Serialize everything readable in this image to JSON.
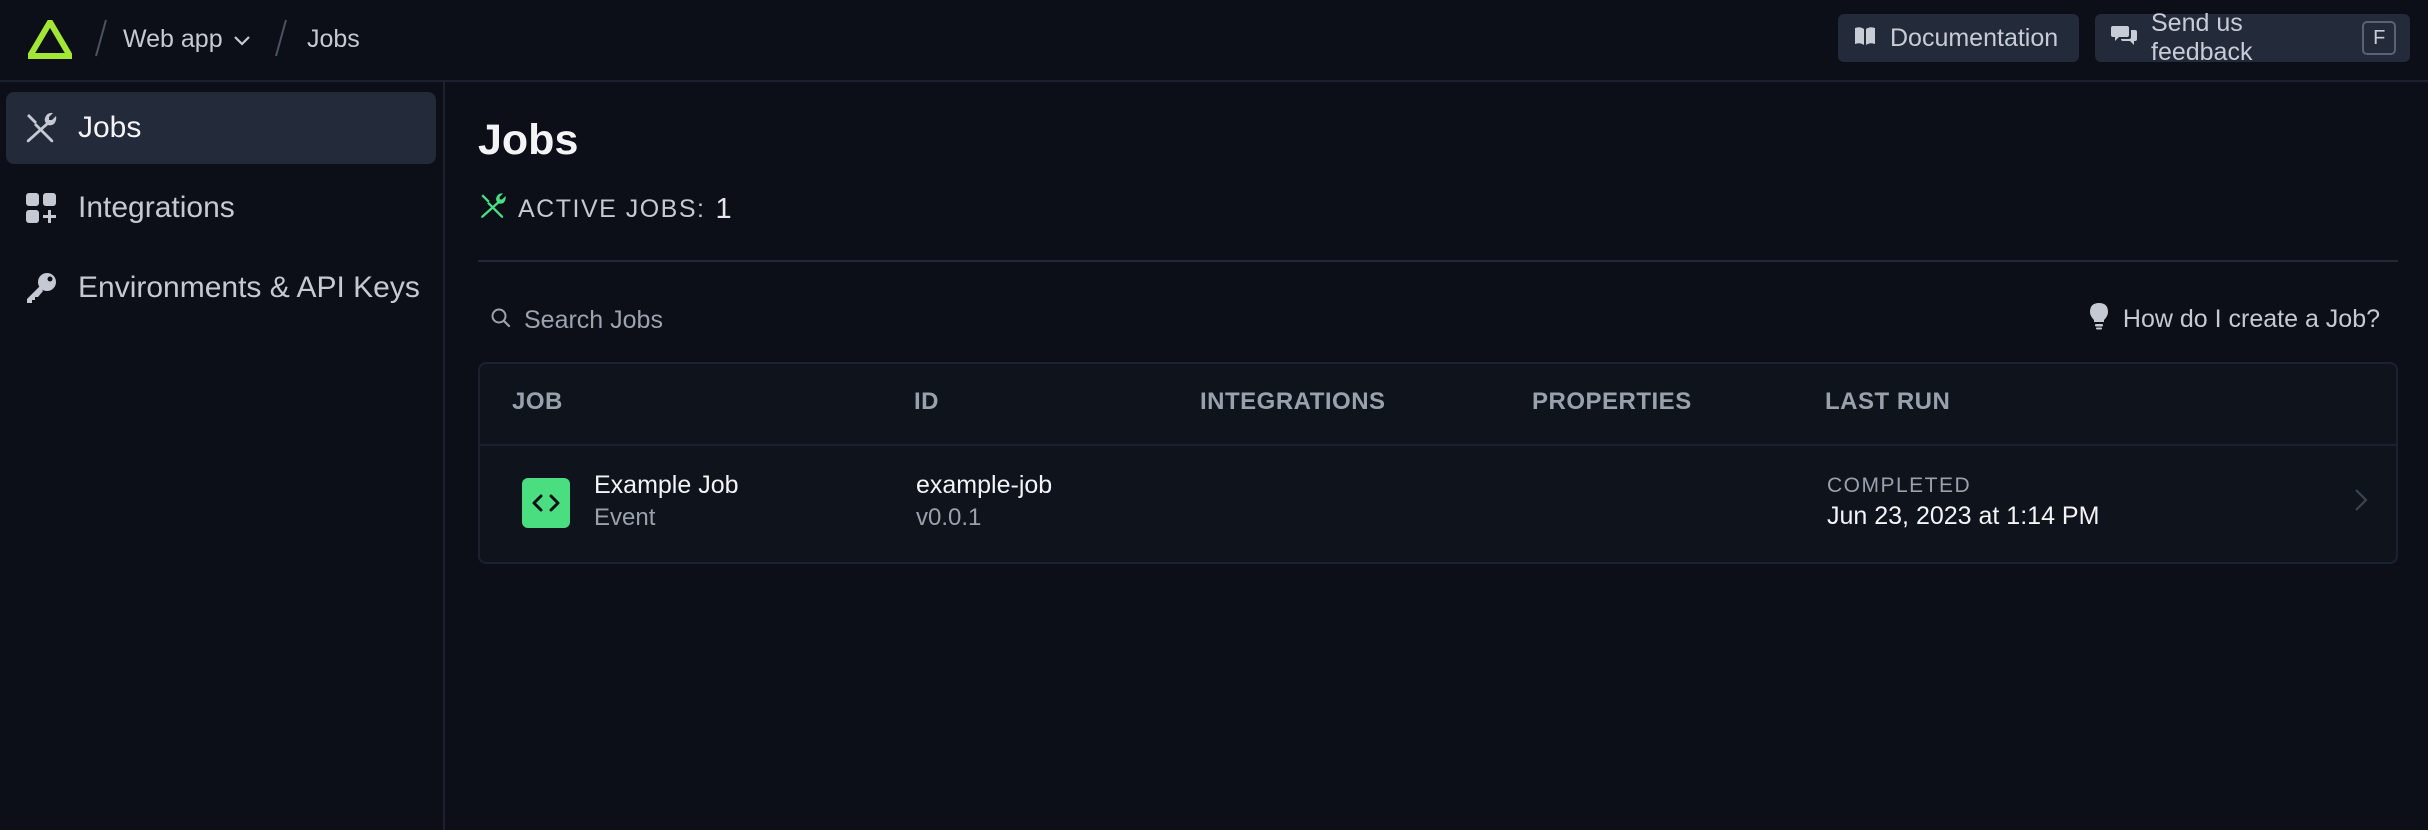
{
  "breadcrumb": {
    "project": "Web app",
    "page": "Jobs"
  },
  "header_buttons": {
    "documentation": "Documentation",
    "feedback": "Send us feedback",
    "feedback_shortcut": "F"
  },
  "sidebar": {
    "items": [
      {
        "label": "Jobs",
        "icon": "wrench-screwdriver-icon",
        "active": true
      },
      {
        "label": "Integrations",
        "icon": "squares-plus-icon",
        "active": false
      },
      {
        "label": "Environments & API Keys",
        "icon": "key-icon",
        "active": false
      }
    ]
  },
  "main": {
    "title": "Jobs",
    "active_jobs_label": "ACTIVE JOBS:",
    "active_jobs_count": "1",
    "search_placeholder": "Search Jobs",
    "help_link": "How do I create a Job?"
  },
  "table": {
    "columns": [
      "JOB",
      "ID",
      "INTEGRATIONS",
      "PROPERTIES",
      "LAST RUN"
    ],
    "rows": [
      {
        "name": "Example Job",
        "trigger": "Event",
        "id": "example-job",
        "version": "v0.0.1",
        "integrations": "",
        "properties": "",
        "status": "COMPLETED",
        "last_run": "Jun 23, 2023 at 1:14 PM"
      }
    ]
  },
  "colors": {
    "brand_green": "#4ade80",
    "logo_green": "#a3e635",
    "background": "#0c0f17",
    "active_item": "#232a3a"
  }
}
